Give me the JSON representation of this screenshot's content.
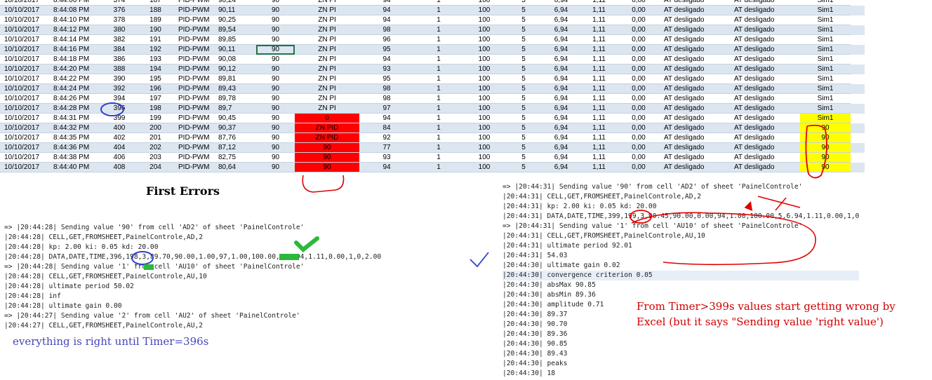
{
  "sheet": {
    "rows": [
      [
        "10/10/2017",
        "8:44:06 PM",
        "374",
        "187",
        "PID-PWM",
        "90,24",
        "90",
        "ZN PI",
        "94",
        "1",
        "100",
        "5",
        "6,94",
        "1,11",
        "0,00",
        "AT desligado",
        "AT desligado",
        "Sim1"
      ],
      [
        "10/10/2017",
        "8:44:08 PM",
        "376",
        "188",
        "PID-PWM",
        "90,11",
        "90",
        "ZN PI",
        "94",
        "1",
        "100",
        "5",
        "6,94",
        "1,11",
        "0,00",
        "AT desligado",
        "AT desligado",
        "Sim1"
      ],
      [
        "10/10/2017",
        "8:44:10 PM",
        "378",
        "189",
        "PID-PWM",
        "90,25",
        "90",
        "ZN PI",
        "94",
        "1",
        "100",
        "5",
        "6,94",
        "1,11",
        "0,00",
        "AT desligado",
        "AT desligado",
        "Sim1"
      ],
      [
        "10/10/2017",
        "8:44:12 PM",
        "380",
        "190",
        "PID-PWM",
        "89,54",
        "90",
        "ZN PI",
        "98",
        "1",
        "100",
        "5",
        "6,94",
        "1,11",
        "0,00",
        "AT desligado",
        "AT desligado",
        "Sim1"
      ],
      [
        "10/10/2017",
        "8:44:14 PM",
        "382",
        "191",
        "PID-PWM",
        "89,85",
        "90",
        "ZN PI",
        "96",
        "1",
        "100",
        "5",
        "6,94",
        "1,11",
        "0,00",
        "AT desligado",
        "AT desligado",
        "Sim1"
      ],
      [
        "10/10/2017",
        "8:44:16 PM",
        "384",
        "192",
        "PID-PWM",
        "90,11",
        "90",
        "ZN PI",
        "95",
        "1",
        "100",
        "5",
        "6,94",
        "1,11",
        "0,00",
        "AT desligado",
        "AT desligado",
        "Sim1"
      ],
      [
        "10/10/2017",
        "8:44:18 PM",
        "386",
        "193",
        "PID-PWM",
        "90,08",
        "90",
        "ZN PI",
        "94",
        "1",
        "100",
        "5",
        "6,94",
        "1,11",
        "0,00",
        "AT desligado",
        "AT desligado",
        "Sim1"
      ],
      [
        "10/10/2017",
        "8:44:20 PM",
        "388",
        "194",
        "PID-PWM",
        "90,12",
        "90",
        "ZN PI",
        "93",
        "1",
        "100",
        "5",
        "6,94",
        "1,11",
        "0,00",
        "AT desligado",
        "AT desligado",
        "Sim1"
      ],
      [
        "10/10/2017",
        "8:44:22 PM",
        "390",
        "195",
        "PID-PWM",
        "89,81",
        "90",
        "ZN PI",
        "95",
        "1",
        "100",
        "5",
        "6,94",
        "1,11",
        "0,00",
        "AT desligado",
        "AT desligado",
        "Sim1"
      ],
      [
        "10/10/2017",
        "8:44:24 PM",
        "392",
        "196",
        "PID-PWM",
        "89,43",
        "90",
        "ZN PI",
        "98",
        "1",
        "100",
        "5",
        "6,94",
        "1,11",
        "0,00",
        "AT desligado",
        "AT desligado",
        "Sim1"
      ],
      [
        "10/10/2017",
        "8:44:26 PM",
        "394",
        "197",
        "PID-PWM",
        "89,78",
        "90",
        "ZN PI",
        "98",
        "1",
        "100",
        "5",
        "6,94",
        "1,11",
        "0,00",
        "AT desligado",
        "AT desligado",
        "Sim1"
      ],
      [
        "10/10/2017",
        "8:44:28 PM",
        "396",
        "198",
        "PID-PWM",
        "89,7",
        "90",
        "ZN PI",
        "97",
        "1",
        "100",
        "5",
        "6,94",
        "1,11",
        "0,00",
        "AT desligado",
        "AT desligado",
        "Sim1"
      ],
      [
        "10/10/2017",
        "8:44:31 PM",
        "399",
        "199",
        "PID-PWM",
        "90,45",
        "90",
        "0",
        "94",
        "1",
        "100",
        "5",
        "6,94",
        "1,11",
        "0,00",
        "AT desligado",
        "AT desligado",
        "Sim1"
      ],
      [
        "10/10/2017",
        "8:44:32 PM",
        "400",
        "200",
        "PID-PWM",
        "90,37",
        "90",
        "ZN PID",
        "84",
        "1",
        "100",
        "5",
        "6,94",
        "1,11",
        "0,00",
        "AT desligado",
        "AT desligado",
        "90"
      ],
      [
        "10/10/2017",
        "8:44:35 PM",
        "402",
        "201",
        "PID-PWM",
        "87,76",
        "90",
        "ZN PID",
        "92",
        "1",
        "100",
        "5",
        "6,94",
        "1,11",
        "0,00",
        "AT desligado",
        "AT desligado",
        "90"
      ],
      [
        "10/10/2017",
        "8:44:36 PM",
        "404",
        "202",
        "PID-PWM",
        "87,12",
        "90",
        "90",
        "77",
        "1",
        "100",
        "5",
        "6,94",
        "1,11",
        "0,00",
        "AT desligado",
        "AT desligado",
        "90"
      ],
      [
        "10/10/2017",
        "8:44:38 PM",
        "406",
        "203",
        "PID-PWM",
        "82,75",
        "90",
        "90",
        "93",
        "1",
        "100",
        "5",
        "6,94",
        "1,11",
        "0,00",
        "AT desligado",
        "AT desligado",
        "90"
      ],
      [
        "10/10/2017",
        "8:44:40 PM",
        "408",
        "204",
        "PID-PWM",
        "80,64",
        "90",
        "90",
        "94",
        "1",
        "100",
        "5",
        "6,94",
        "1,11",
        "0,00",
        "AT desligado",
        "AT desligado",
        "90"
      ]
    ]
  },
  "captions": {
    "first_errors": "First Errors",
    "left": "everything is right until Timer=396s",
    "right_1": "From Timer>399s values start getting wrong by",
    "right_2": "Excel (but it says \"Sending value 'right value')"
  },
  "log_left": [
    "=> |20:44:28| Sending value '90' from cell 'AD2' of sheet 'PainelControle'",
    "|20:44:28| CELL,GET,FROMSHEET,PainelControle,AD,2",
    "|20:44:28| kp: 2.00 ki: 0.05 kd: 20.00",
    "|20:44:28| DATA,DATE,TIME,396,198,3,89.70,90.00,1.00,97,1.00,100.00,5,6.94,1.11,0.00,1,0,2.00",
    "=> |20:44:28| Sending value '1' from cell 'AU10' of sheet 'PainelControle'",
    "|20:44:28| CELL,GET,FROMSHEET,PainelControle,AU,10",
    "|20:44:28| ultimate period 50.02",
    "|20:44:28| inf",
    "|20:44:28| ultimate gain 0.00",
    "=> |20:44:27| Sending value '2' from cell 'AU2' of sheet 'PainelControle'",
    "|20:44:27| CELL,GET,FROMSHEET,PainelControle,AU,2"
  ],
  "log_right": [
    "=> |20:44:31| Sending value '90' from cell 'AD2' of sheet 'PainelControle'",
    "|20:44:31| CELL,GET,FROMSHEET,PainelControle,AD,2",
    "|20:44:31| kp: 2.00 ki: 0.05 kd: 20.00",
    "|20:44:31| DATA,DATE,TIME,399,199,3,90.45,90.00,0.00,94,1.00,100.00,5,6.94,1.11,0.00,1,0",
    "=> |20:44:31| Sending value '1' from cell 'AU10' of sheet 'PainelControle'",
    "|20:44:31| CELL,GET,FROMSHEET,PainelControle,AU,10",
    "|20:44:31| ultimate period 92.01",
    "|20:44:31| 54.03",
    "|20:44:30| ultimate gain 0.02",
    "|20:44:30| convergence criterion 0.05",
    "|20:44:30| absMax 90.85",
    "|20:44:30| absMin 89.36",
    "|20:44:30| amplitude 0.71",
    "|20:44:30| 89.37",
    "|20:44:30| 90.70",
    "|20:44:30| 89.36",
    "|20:44:30| 90.85",
    "|20:44:30| 89.43",
    "|20:44:30| peaks",
    "|20:44:30| 18"
  ],
  "colors": {
    "error_fill": "#ff0000",
    "warning_fill": "#ffff00",
    "annotation_red": "#d10000",
    "annotation_blue": "#2f3fd0",
    "annotation_green": "#2db83d"
  }
}
